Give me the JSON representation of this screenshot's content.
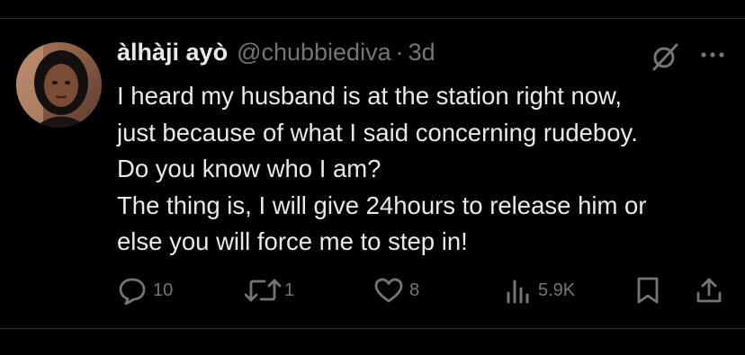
{
  "tweet": {
    "author": {
      "display_name": "àlhàji ayò",
      "handle": "@chubbiediva",
      "separator": "·",
      "time": "3d"
    },
    "text_lines": [
      "I heard my husband is at the station right now,",
      "just because of what I said concerning rudeboy.",
      "Do you know who I am?",
      "The thing is, I will give 24hours to release him or",
      "else you will force me to step in!"
    ],
    "actions": {
      "replies": "10",
      "reposts": "1",
      "likes": "8",
      "views": "5.9K"
    },
    "icons": [
      "grok-icon",
      "more-icon",
      "reply-icon",
      "repost-icon",
      "like-icon",
      "views-icon",
      "bookmark-icon",
      "share-icon"
    ]
  },
  "colors": {
    "background": "#000000",
    "primary_text": "#e7e9ea",
    "secondary_text": "#71767b",
    "divider": "#2f3336"
  }
}
